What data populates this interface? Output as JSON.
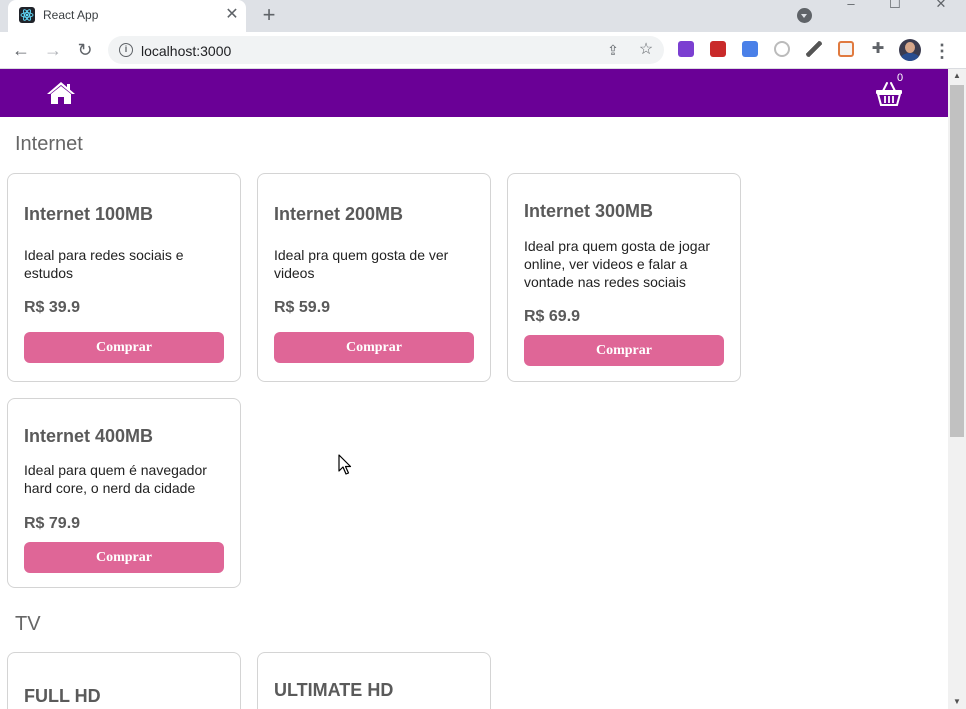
{
  "browser": {
    "tab_title": "React App",
    "tab_close": "✕",
    "new_tab": "+",
    "url": "localhost:3000",
    "extensions": [
      "vpn-extension",
      "adblock-extension",
      "translate-extension",
      "recorder-extension",
      "eyedropper-extension",
      "calendar-extension",
      "puzzle-extension"
    ]
  },
  "header": {
    "home_icon": "home-icon",
    "cart_icon": "basket-icon",
    "cart_count": "0",
    "bg_color": "#6a0096"
  },
  "sections": [
    {
      "title": "Internet",
      "products": [
        {
          "name": "Internet 100MB",
          "description": "Ideal para redes sociais e estudos",
          "price": "R$ 39.9",
          "button": "Comprar"
        },
        {
          "name": "Internet 200MB",
          "description": "Ideal pra quem gosta de ver videos",
          "price": "R$ 59.9",
          "button": "Comprar"
        },
        {
          "name": "Internet 300MB",
          "description": "Ideal pra quem gosta de jogar online, ver videos e falar a vontade nas redes sociais",
          "price": "R$ 69.9",
          "button": "Comprar"
        },
        {
          "name": "Internet 400MB",
          "description": "Ideal para quem é navegador hard core, o nerd da cidade",
          "price": "R$ 79.9",
          "button": "Comprar"
        }
      ]
    },
    {
      "title": "TV",
      "products": [
        {
          "name": "FULL HD"
        },
        {
          "name": "ULTIMATE HD"
        }
      ]
    }
  ],
  "colors": {
    "accent_button": "#df6697",
    "card_border": "#d4d4d4"
  }
}
